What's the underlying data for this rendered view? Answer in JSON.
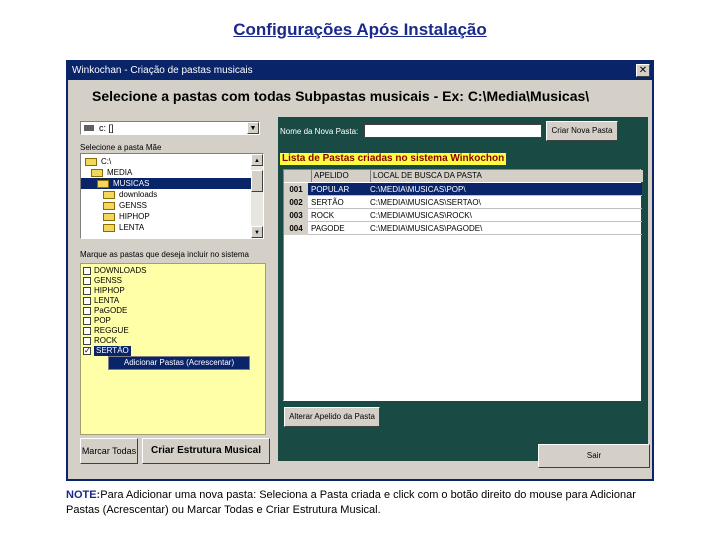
{
  "slide_title": "Configurações Após Instalação",
  "window": {
    "title": "Winkochan - Criação de pastas musicais",
    "close_label": "✕",
    "header": "Selecione a pastas com todas Subpastas musicais - Ex:  C:\\Media\\Musicas\\",
    "drive": {
      "value": "c: []",
      "dropdown_arrow": "▼"
    },
    "folder_select_label": "Selecione a pasta Mãe",
    "folder_tree": [
      {
        "label": "C:\\",
        "selected": false,
        "indent": 0
      },
      {
        "label": "MEDIA",
        "selected": false,
        "indent": 1
      },
      {
        "label": "MUSICAS",
        "selected": true,
        "indent": 2
      },
      {
        "label": "downloads",
        "selected": false,
        "indent": 3
      },
      {
        "label": "GENSS",
        "selected": false,
        "indent": 3
      },
      {
        "label": "HIPHOP",
        "selected": false,
        "indent": 3
      },
      {
        "label": "LENTA",
        "selected": false,
        "indent": 3
      }
    ],
    "checklist_label": "Marque as pastas que deseja incluir no sistema",
    "checklist": [
      {
        "label": "DOWNLOADS",
        "checked": false
      },
      {
        "label": "GENSS",
        "checked": false
      },
      {
        "label": "HIPHOP",
        "checked": false
      },
      {
        "label": "LENTA",
        "checked": false
      },
      {
        "label": "PaGODE",
        "checked": false
      },
      {
        "label": "POP",
        "checked": false
      },
      {
        "label": "REGGUE",
        "checked": false
      },
      {
        "label": "ROCK",
        "checked": false
      },
      {
        "label": "SERTÃO",
        "checked": true
      }
    ],
    "context_menu_item": "Adicionar Pastas (Acrescentar)",
    "new_folder_label": "Nome da Nova Pasta:",
    "new_folder_value": "",
    "create_folder_button": "Criar Nova Pasta",
    "list_title": "Lista de Pastas criadas no sistema Winkochon",
    "grid": {
      "columns": [
        "",
        "APELIDO",
        "LOCAL DE BUSCA DA PASTA"
      ],
      "rows": [
        {
          "id": "001",
          "apelido": "POPULAR",
          "local": "C:\\MEDIA\\MUSICAS\\POP\\",
          "selected": true
        },
        {
          "id": "002",
          "apelido": "SERTÃO",
          "local": "C:\\MEDIA\\MUSICAS\\SERTAO\\",
          "selected": false
        },
        {
          "id": "003",
          "apelido": "ROCK",
          "local": "C:\\MEDIA\\MUSICAS\\ROCK\\",
          "selected": false
        },
        {
          "id": "004",
          "apelido": "PAGODE",
          "local": "C:\\MEDIA\\MUSICAS\\PAGODE\\",
          "selected": false
        }
      ]
    },
    "alter_nick_button": "Alterar Apelido da Pasta",
    "mark_all_button": "Marcar Todas",
    "create_structure_button": "Criar Estrutura Musical",
    "exit_button": "Sair"
  },
  "note": {
    "prefix": "NOTE:",
    "text": "Para Adicionar uma nova pasta: Seleciona a Pasta criada e click com o botão direito do mouse para Adicionar Pastas (Acrescentar) ou Marcar Todas e Criar Estrutura Musical."
  }
}
